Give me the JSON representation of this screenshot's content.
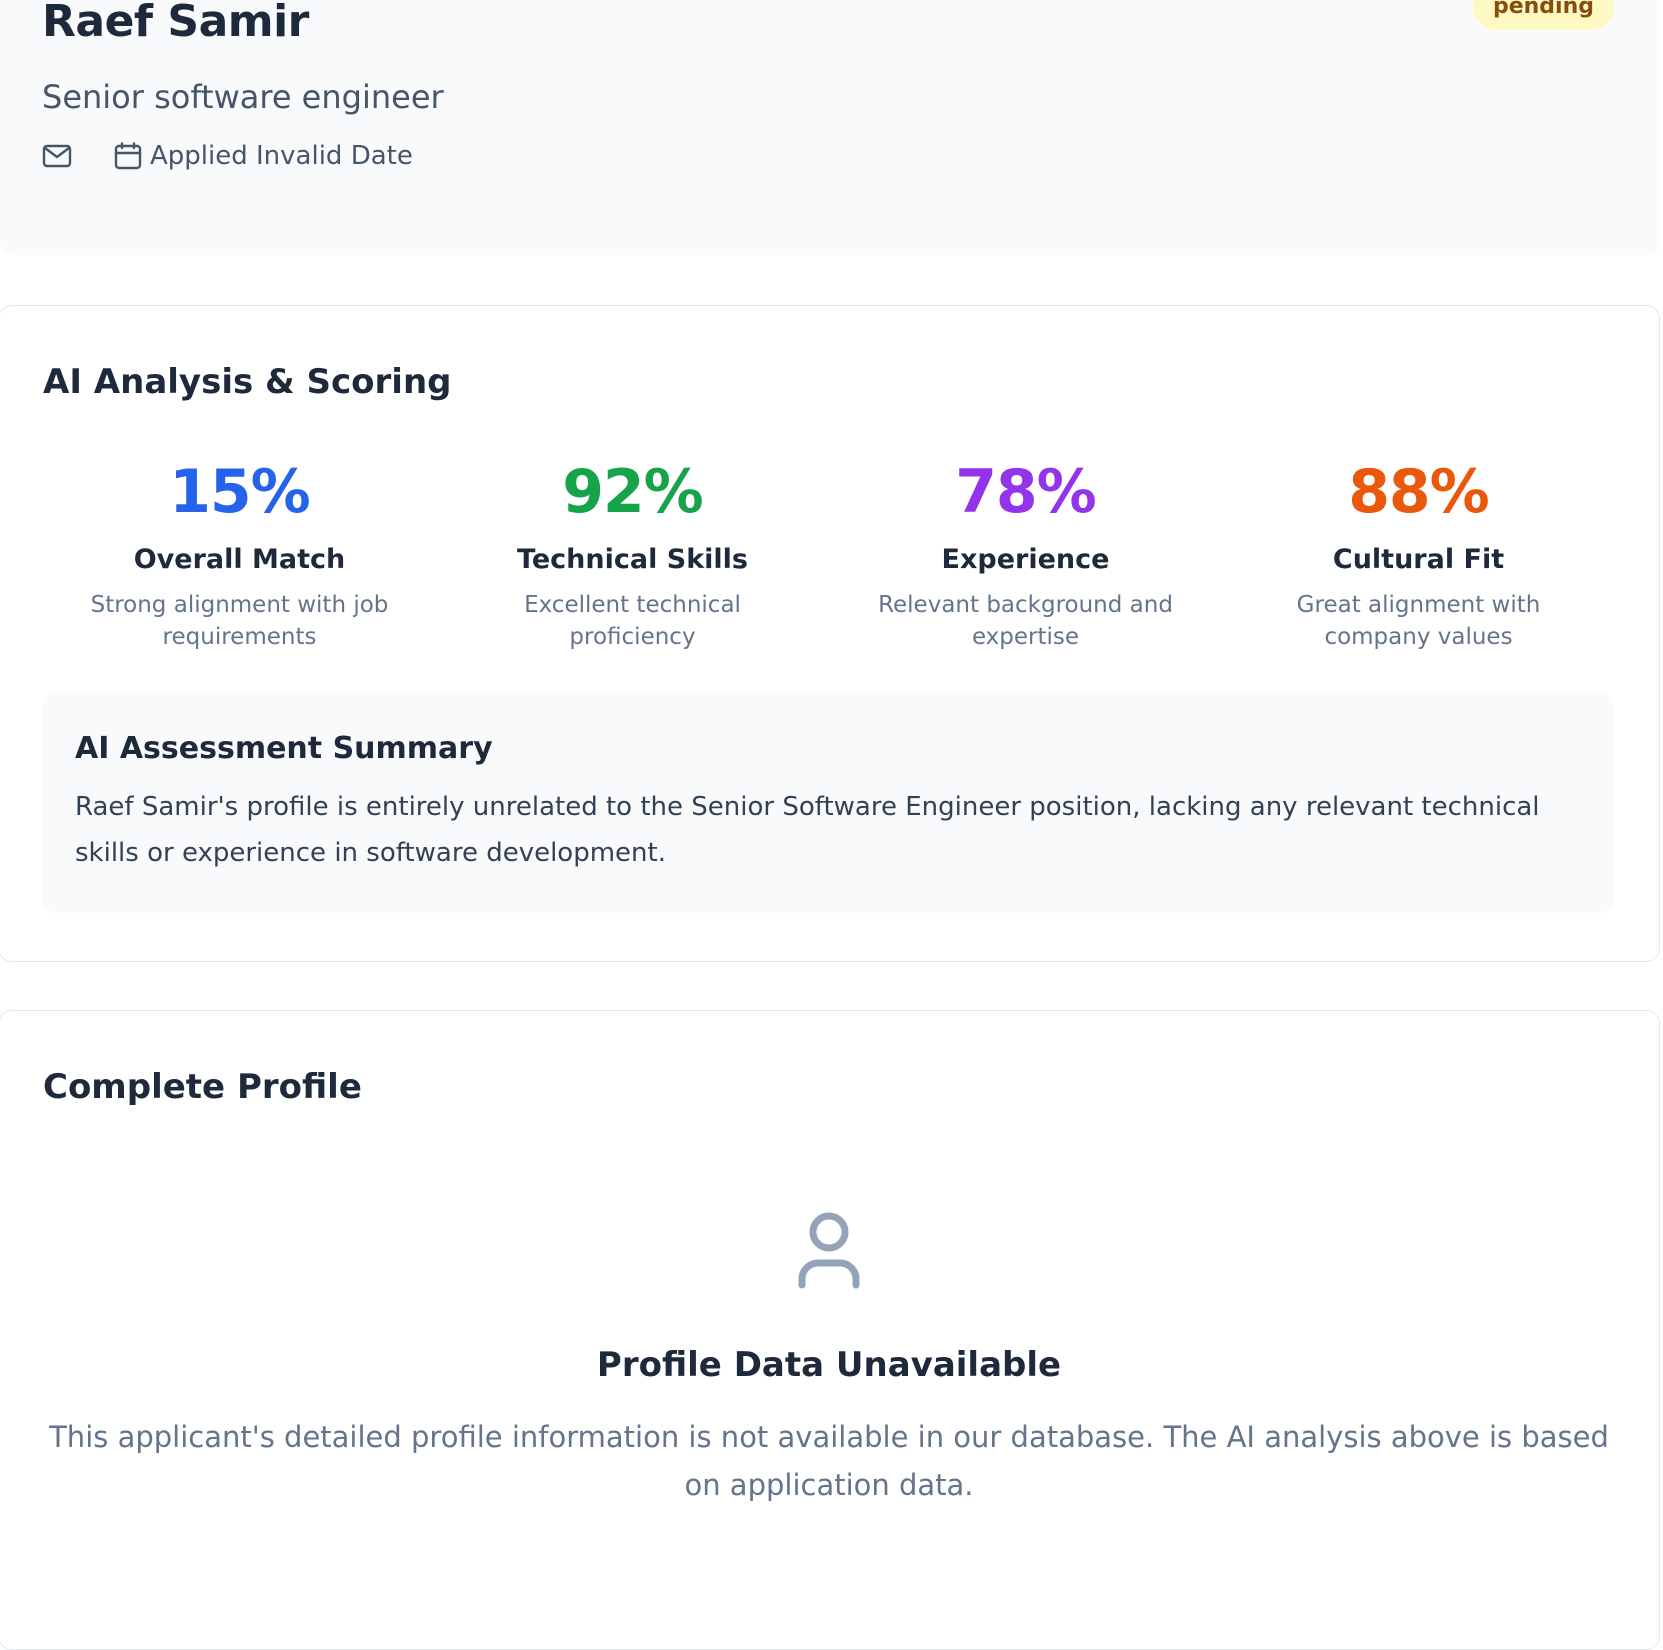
{
  "applicant": {
    "name": "Raef Samir",
    "status": "pending",
    "job_title": "Senior software engineer",
    "applied_text": "Applied Invalid Date"
  },
  "icons": {
    "mail": "mail-icon",
    "calendar": "calendar-icon",
    "user": "user-icon"
  },
  "analysis": {
    "title": "AI Analysis & Scoring",
    "scores": [
      {
        "value": "15%",
        "label": "Overall Match",
        "description": "Strong alignment with job requirements",
        "color": "#2563eb"
      },
      {
        "value": "92%",
        "label": "Technical Skills",
        "description": "Excellent technical proficiency",
        "color": "#16a34a"
      },
      {
        "value": "78%",
        "label": "Experience",
        "description": "Relevant background and expertise",
        "color": "#9333ea"
      },
      {
        "value": "88%",
        "label": "Cultural Fit",
        "description": "Great alignment with company values",
        "color": "#ea580c"
      }
    ],
    "summary": {
      "title": "AI Assessment Summary",
      "text": "Raef Samir's profile is entirely unrelated to the Senior Software Engineer position, lacking any relevant technical skills or experience in software development."
    }
  },
  "profile": {
    "title": "Complete Profile",
    "empty_title": "Profile Data Unavailable",
    "empty_text": "This applicant's detailed profile information is not available in our database. The AI analysis above is based on application data."
  },
  "colors": {
    "status_bg": "#fef9c3",
    "status_text": "#854d0e",
    "muted": "#64748b",
    "heading": "#1e293b"
  }
}
